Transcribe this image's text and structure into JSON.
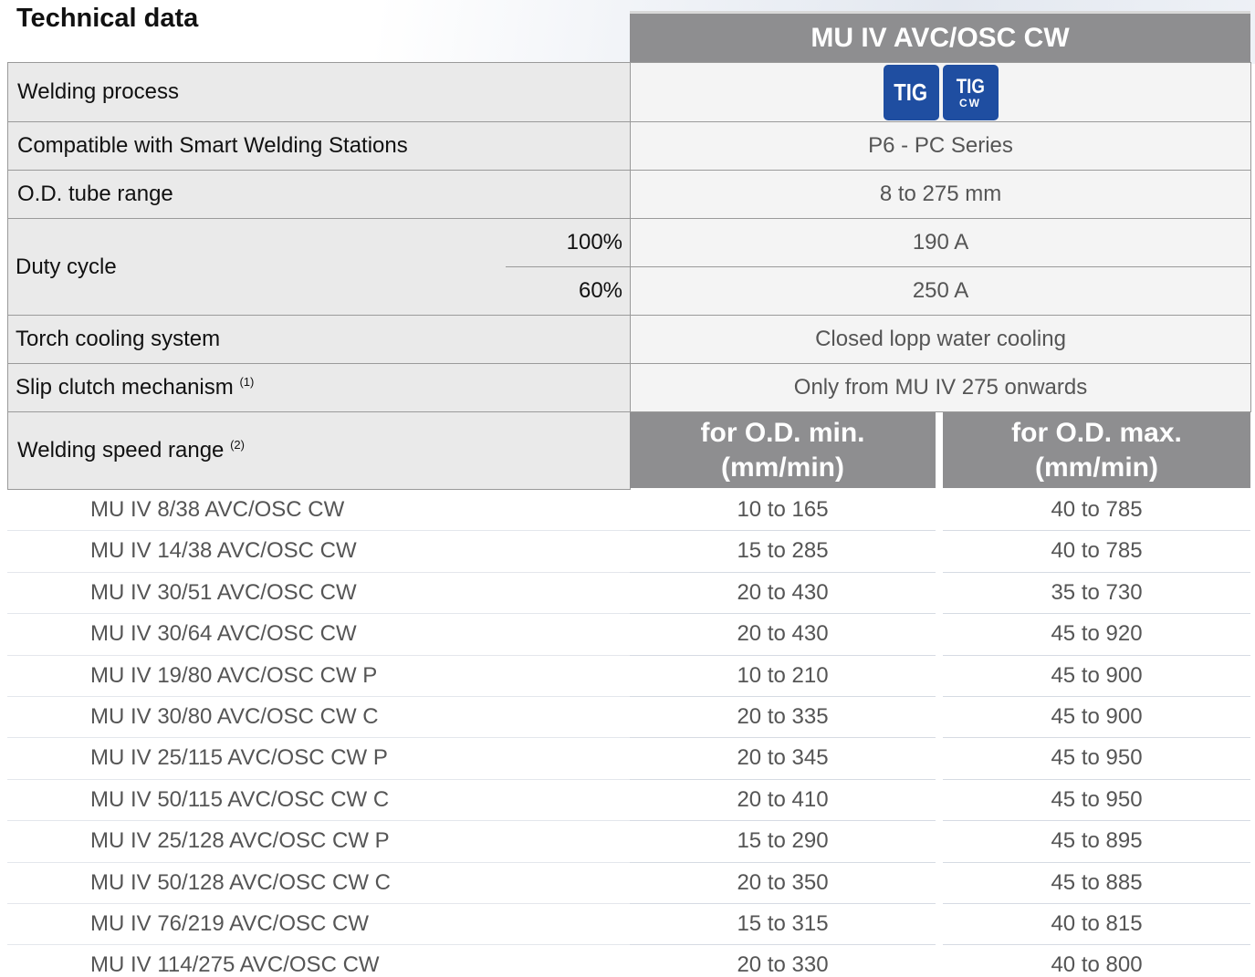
{
  "title": "Technical data",
  "product": "MU IV AVC/OSC CW",
  "colors": {
    "header_bg": "#8e8e90",
    "tig_badge": "#1f4ea1"
  },
  "specs": {
    "welding_process": {
      "label": "Welding process",
      "badges": [
        {
          "icon": "tig-badge-icon",
          "text": "TIG",
          "sub": ""
        },
        {
          "icon": "tig-cw-badge-icon",
          "text": "TIG",
          "sub": "CW"
        }
      ]
    },
    "stations": {
      "label": "Compatible with Smart Welding Stations",
      "value": "P6 - PC Series"
    },
    "od_range": {
      "label": "O.D. tube range",
      "value": "8 to 275 mm"
    },
    "duty_cycle": {
      "label": "Duty cycle",
      "rows": [
        {
          "pct": "100%",
          "value": "190 A"
        },
        {
          "pct": "60%",
          "value": "250 A"
        }
      ]
    },
    "cooling": {
      "label": "Torch cooling system",
      "value": "Closed lopp water cooling"
    },
    "slip_clutch": {
      "label": "Slip clutch mechanism",
      "note": "(1)",
      "value": "Only from MU IV 275 onwards"
    },
    "speed": {
      "label": "Welding speed range",
      "note": "(2)",
      "col_min": [
        "for O.D. min.",
        "(mm/min)"
      ],
      "col_max": [
        "for O.D. max.",
        "(mm/min)"
      ]
    }
  },
  "models": [
    {
      "name": "MU IV 8/38 AVC/OSC CW",
      "min": "10 to 165",
      "max": "40 to 785"
    },
    {
      "name": "MU IV 14/38 AVC/OSC CW",
      "min": "15 to 285",
      "max": "40 to 785"
    },
    {
      "name": "MU IV 30/51 AVC/OSC CW",
      "min": "20 to 430",
      "max": "35 to 730"
    },
    {
      "name": "MU IV 30/64 AVC/OSC CW",
      "min": "20 to 430",
      "max": "45 to 920"
    },
    {
      "name": "MU IV 19/80 AVC/OSC CW P",
      "min": "10 to 210",
      "max": "45 to 900"
    },
    {
      "name": "MU IV 30/80 AVC/OSC CW C",
      "min": "20 to 335",
      "max": "45 to 900"
    },
    {
      "name": "MU IV 25/115 AVC/OSC CW P",
      "min": "20 to 345",
      "max": "45 to 950"
    },
    {
      "name": "MU IV 50/115 AVC/OSC CW C",
      "min": "20 to 410",
      "max": "45 to 950"
    },
    {
      "name": "MU IV 25/128 AVC/OSC CW P",
      "min": "15 to 290",
      "max": "45 to 895"
    },
    {
      "name": "MU IV 50/128 AVC/OSC CW C",
      "min": "20 to 350",
      "max": "45 to 885"
    },
    {
      "name": "MU IV 76/219 AVC/OSC CW",
      "min": "15 to 315",
      "max": "40 to 815"
    },
    {
      "name": "MU IV 114/275 AVC/OSC CW",
      "min": "20 to 330",
      "max": "40 to 800"
    }
  ]
}
